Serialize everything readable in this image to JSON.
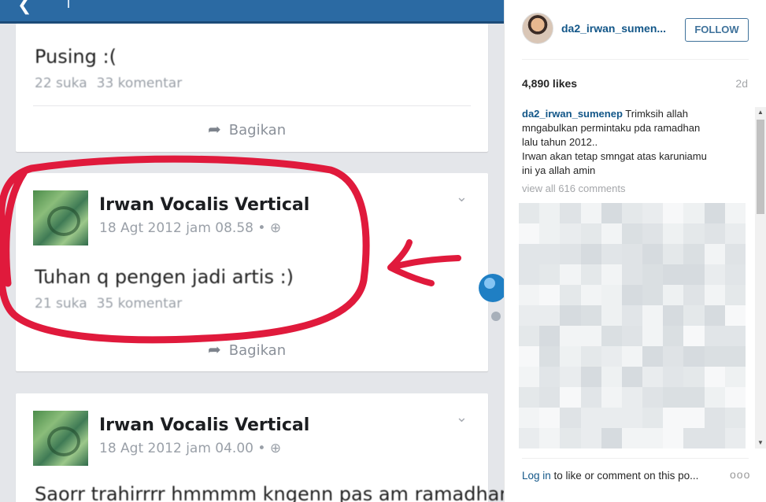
{
  "photo": {
    "cards": [
      {
        "text": "Pusing :(",
        "likes": "22 suka",
        "comments": "33 komentar",
        "share": "Bagikan"
      },
      {
        "author": "Irwan Vocalis Vertical",
        "time": "18 Agt 2012 jam 08.58 •",
        "text": "Tuhan q pengen jadi artis :)",
        "likes": "21 suka",
        "comments": "35 komentar",
        "share": "Bagikan"
      },
      {
        "author": "Irwan Vocalis Vertical",
        "time": "18 Agt 2012 jam 04.00 •",
        "text": "Saorr trahirrrr hmmmm kngenn pas am ramadhan"
      }
    ],
    "annotation_color": "#e01a3c"
  },
  "panel": {
    "username": "da2_irwan_sumen...",
    "follow_label": "FOLLOW",
    "likes": "4,890 likes",
    "age": "2d",
    "caption_user": "da2_irwan_sumenep",
    "caption_lines": [
      "Trimksih allah",
      "mngabulkan permintaku pda ramadhan",
      "lalu tahun 2012..",
      "Irwan akan tetap smngat atas karuniamu",
      "ini ya allah amin"
    ],
    "view_all": "view all 616 comments",
    "login_link": "Log in",
    "login_rest": " to like or comment on this po...",
    "more": "ooo",
    "accent_color": "#125688"
  }
}
